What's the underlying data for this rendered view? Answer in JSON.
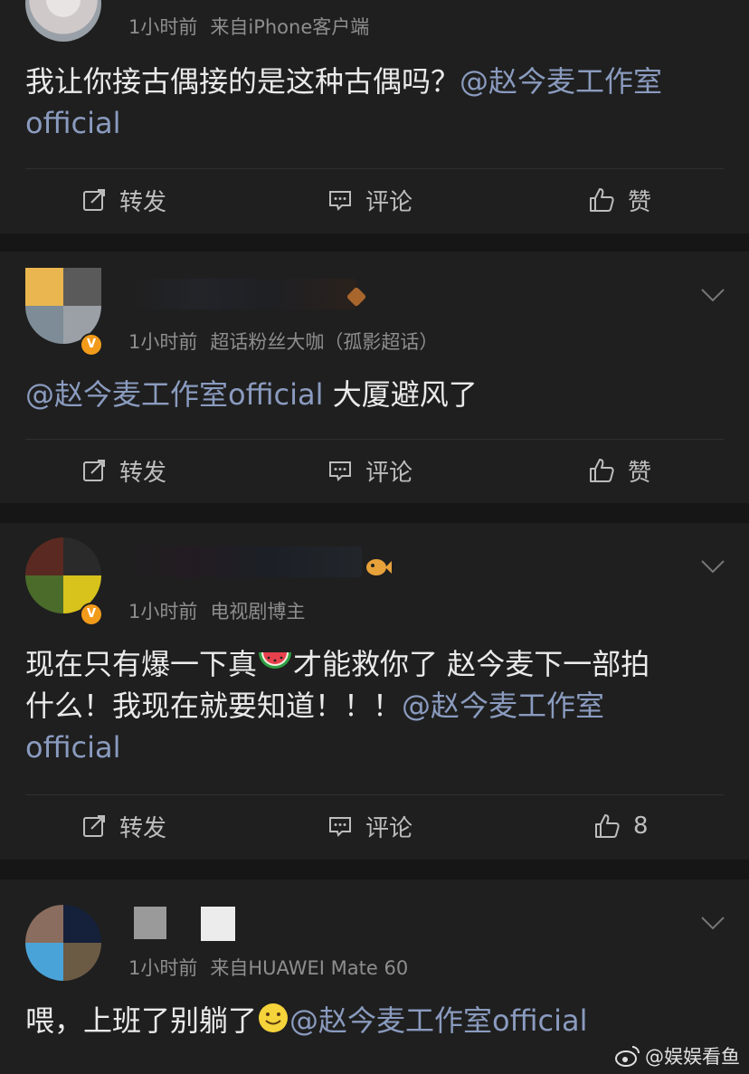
{
  "posts": [
    {
      "time": "1小时前",
      "source": "来自iPhone客户端",
      "text": "我让你接古偶接的是这种古偶吗？",
      "mention": "@赵今麦工作室official",
      "repost": "转发",
      "comment": "评论",
      "like": "赞"
    },
    {
      "time": "1小时前",
      "source": "超话粉丝大咖（孤影超话）",
      "mention": "@赵今麦工作室official",
      "text": " 大厦避风了",
      "verified": "V",
      "repost": "转发",
      "comment": "评论",
      "like": "赞"
    },
    {
      "time": "1小时前",
      "source": "电视剧博主",
      "text_a": "现在只有爆一下真",
      "text_b": "才能救你了 赵今麦下一部拍",
      "text_c": "什么！我现在就要知道！！！",
      "mention": "@赵今麦工作室",
      "mention_tail": "official",
      "verified": "V",
      "repost": "转发",
      "comment": "评论",
      "like": "8"
    },
    {
      "time": "1小时前",
      "source": "来自HUAWEI Mate 60",
      "text": "喂，上班了别躺了",
      "mention": "@赵今麦工作室official"
    }
  ],
  "watermark": "@娱娱看鱼",
  "colors": {
    "background": "#161616",
    "card": "#1f1f1f",
    "mention": "#8a9bbf",
    "meta": "#8e8e8e",
    "verified": "#f29b1b"
  }
}
